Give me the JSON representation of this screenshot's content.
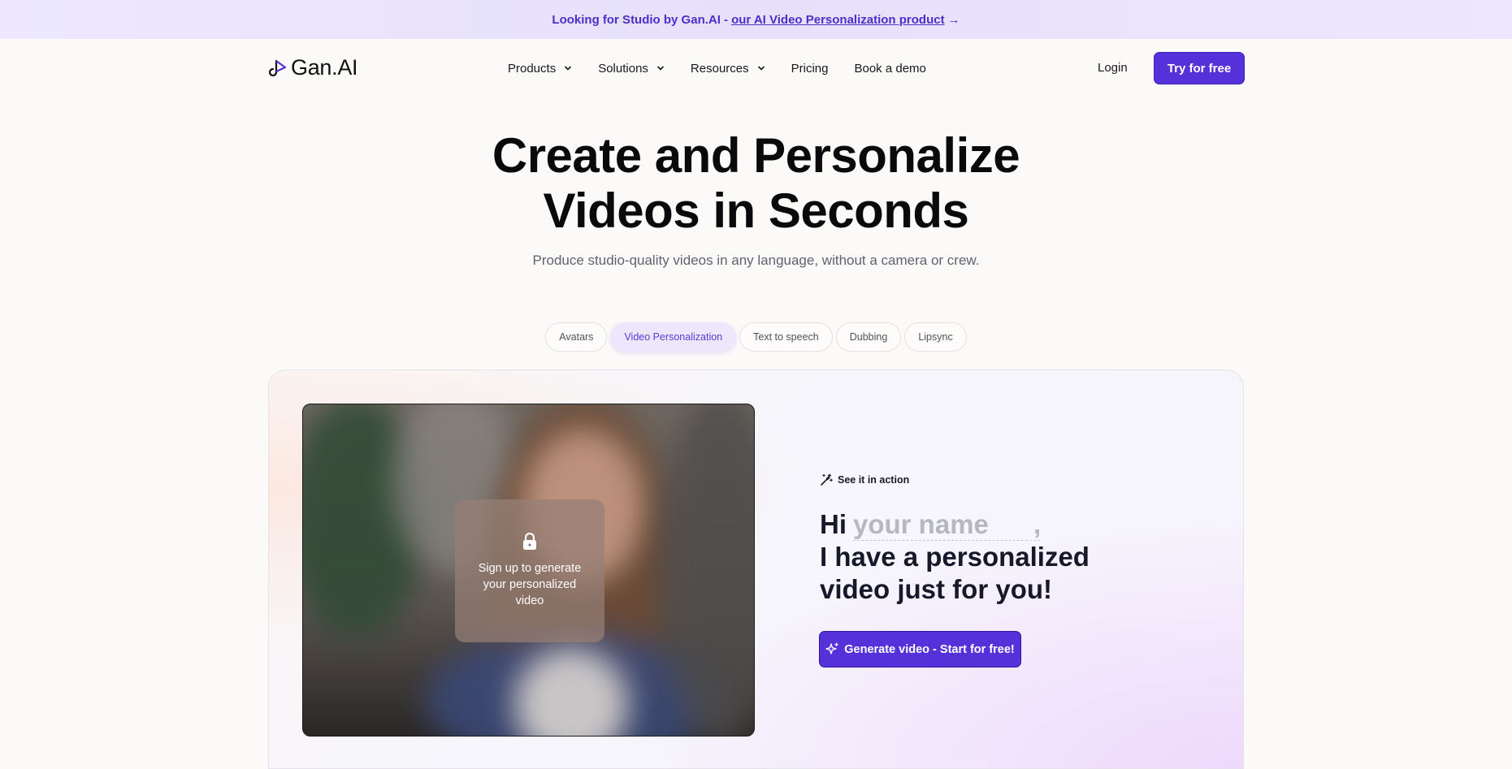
{
  "banner": {
    "text": "Looking for Studio by Gan.AI -",
    "link": "our AI Video Personalization product",
    "arrow": "→"
  },
  "nav": {
    "logo": "Gan.AI",
    "menu": [
      {
        "label": "Products",
        "dropdown": true
      },
      {
        "label": "Solutions",
        "dropdown": true
      },
      {
        "label": "Resources",
        "dropdown": true
      },
      {
        "label": "Pricing",
        "dropdown": false
      },
      {
        "label": "Book a demo",
        "dropdown": false
      }
    ],
    "login": "Login",
    "cta": "Try for free"
  },
  "hero": {
    "title_line1": "Create and Personalize",
    "title_line2": "Videos in Seconds",
    "subtitle": "Produce studio-quality videos in any language, without a camera or crew."
  },
  "tabs": [
    {
      "label": "Avatars",
      "active": false
    },
    {
      "label": "Video Personalization",
      "active": true
    },
    {
      "label": "Text to speech",
      "active": false
    },
    {
      "label": "Dubbing",
      "active": false
    },
    {
      "label": "Lipsync",
      "active": false
    }
  ],
  "demo": {
    "lock_text": "Sign up to generate your personalized video",
    "see_action": "See it in action",
    "greeting": "Hi",
    "name_placeholder": "your name",
    "comma": ",",
    "line2": "I have a personalized",
    "line3": "video just for you!",
    "button": "Generate video - Start for free!"
  },
  "colors": {
    "brand": "#5431d8",
    "banner_bg": "#ebe6fc",
    "tab_active_bg": "#ece7fc"
  }
}
